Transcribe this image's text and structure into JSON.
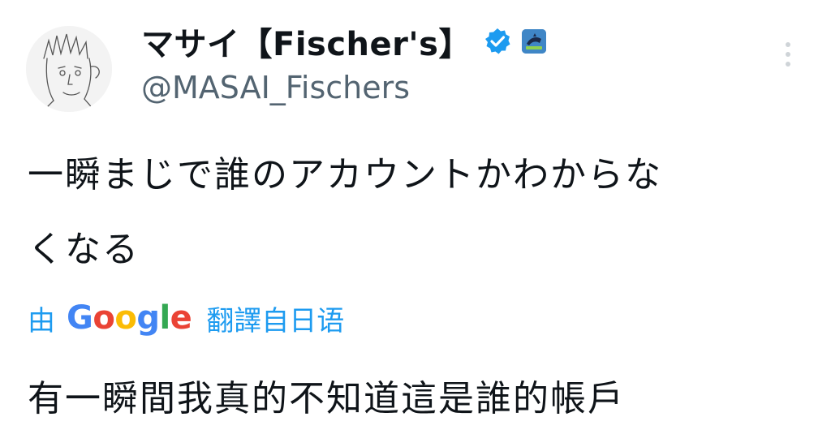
{
  "user": {
    "display_name": "マサイ【Fischer's】",
    "handle": "@MASAI_Fischers"
  },
  "tweet": {
    "text_line1": "一瞬まじで誰のアカウントかわからな",
    "text_line2": "くなる"
  },
  "translation": {
    "prefix": "由",
    "brand": [
      "G",
      "o",
      "o",
      "g",
      "l",
      "e"
    ],
    "suffix": "翻譯自日语",
    "text": "有一瞬間我真的不知道這是誰的帳戶"
  },
  "colors": {
    "link": "#1d9bf0",
    "verified": "#1d9bf0",
    "handle": "#536471",
    "text": "#0f1419"
  },
  "icons": {
    "verified": "verified-badge-icon",
    "affiliate": "affiliate-badge-icon",
    "more": "more-vertical-icon"
  }
}
